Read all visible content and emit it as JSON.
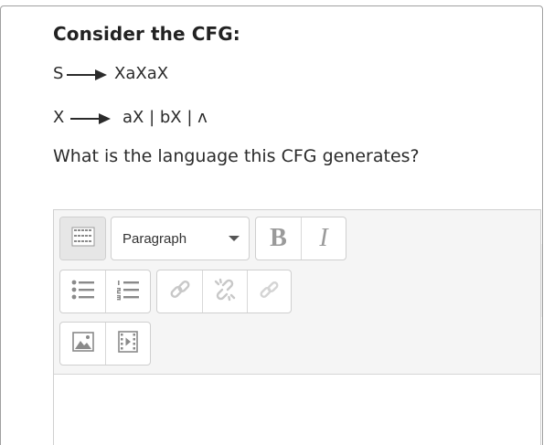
{
  "question": {
    "title": "Consider the CFG:",
    "rules": [
      {
        "lhs": "S",
        "rhs": "XaXaX"
      },
      {
        "lhs": "X",
        "rhs": "aX | bX | ʌ"
      }
    ],
    "prompt": "What is the language this CFG generates?"
  },
  "editor": {
    "toolbar": {
      "toggle_icon": "toolbar-toggle-icon",
      "paragraph_select": {
        "selected": "Paragraph"
      },
      "bold_label": "B",
      "italic_label": "I",
      "icons": {
        "unordered_list": "unordered-list-icon",
        "ordered_list": "ordered-list-icon",
        "link": "link-icon",
        "unlink": "unlink-icon",
        "manage_links": "manage-links-icon",
        "image": "image-icon",
        "media": "media-icon"
      }
    },
    "content": ""
  },
  "colors": {
    "text": "#2b2b2b",
    "toolbar_bg": "#f5f5f5",
    "border": "#cfcfcf",
    "disabled_icon": "#c8c8c8"
  }
}
